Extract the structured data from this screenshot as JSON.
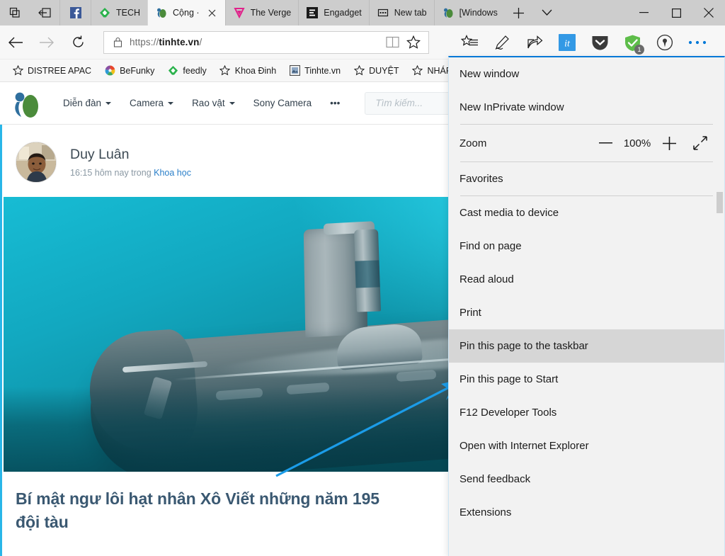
{
  "window": {
    "controls": {
      "minimize": "—",
      "maximize": "□",
      "close": "✕"
    },
    "new_tab_label": "+",
    "tab_menu_label": "⌄"
  },
  "tabstrip": {
    "sys_buttons": [
      {
        "name": "tab-preview-icon",
        "glyph": "tab-preview"
      },
      {
        "name": "set-aside-tabs-icon",
        "glyph": "set-aside"
      }
    ],
    "tabs": [
      {
        "title": "",
        "favicon": "facebook",
        "pinned": true,
        "active": false
      },
      {
        "title": "TECH",
        "favicon": "feedly",
        "pinned": false,
        "active": false
      },
      {
        "title": "Cộng ·",
        "favicon": "tinhte",
        "pinned": false,
        "active": true
      },
      {
        "title": "The Verge",
        "favicon": "theverge",
        "pinned": false,
        "active": false
      },
      {
        "title": "Engadget",
        "favicon": "engadget",
        "pinned": false,
        "active": false
      },
      {
        "title": "New tab",
        "favicon": "newtab",
        "pinned": false,
        "active": false
      },
      {
        "title": "[Windows",
        "favicon": "tinhte",
        "pinned": false,
        "active": false
      }
    ]
  },
  "toolbar": {
    "back_label": "Back",
    "forward_label": "Forward",
    "refresh_label": "Refresh",
    "url_prefix": "https://",
    "url_domain": "tinhte.vn",
    "url_suffix": "/",
    "url_full": "https://tinhte.vn/",
    "reading_view_label": "Reading view",
    "favorite_label": "Add to favorites",
    "right_icons": [
      {
        "name": "hub-favorites-icon",
        "label": "Hub"
      },
      {
        "name": "web-notes-icon",
        "label": "Make a Web Note"
      },
      {
        "name": "share-icon",
        "label": "Share"
      },
      {
        "name": "extension-tinhte-icon",
        "label": "it",
        "color": "#3399e5"
      },
      {
        "name": "pocket-extension-icon",
        "label": "Pocket",
        "color": "#3a3a3a"
      },
      {
        "name": "adblock-extension-icon",
        "label": "Adblock",
        "color": "#5ebd4a",
        "badge": "1"
      },
      {
        "name": "lastpass-extension-icon",
        "label": "LastPass",
        "color": "#3a3a3a"
      },
      {
        "name": "settings-and-more-icon",
        "label": "•••",
        "color": "#0078d7"
      }
    ]
  },
  "favorites_bar": [
    {
      "label": "DISTREE APAC",
      "icon": "star"
    },
    {
      "label": "BeFunky",
      "icon": "befunky"
    },
    {
      "label": "feedly",
      "icon": "feedly"
    },
    {
      "label": "Khoa Đinh",
      "icon": "star"
    },
    {
      "label": "Tinhte.vn",
      "icon": "tinhte-fav"
    },
    {
      "label": "DUYỆT",
      "icon": "star"
    },
    {
      "label": "NHÁP",
      "icon": "star"
    },
    {
      "label": "",
      "icon": "star"
    }
  ],
  "site": {
    "logo_name": "tinhte-logo",
    "nav": [
      {
        "label": "Diễn đàn",
        "caret": true
      },
      {
        "label": "Camera",
        "caret": true
      },
      {
        "label": "Rao vật",
        "caret": true
      },
      {
        "label": "Sony Camera",
        "caret": false
      },
      {
        "label": "•••",
        "caret": false
      }
    ],
    "search_placeholder": "Tìm kiếm..."
  },
  "post": {
    "author": "Duy Luân",
    "time_prefix": "16:15 hôm nay trong ",
    "category": "Khoa học",
    "hero_alt": "nuclear-torpedo-submarine-illustration",
    "title": "Bí mật ngư lôi hạt nhân Xô Viết những năm 195Đội tàu",
    "title_line1": "Bí mật ngư lôi hạt nhân Xô Viết những năm 195",
    "title_line2": "đội tàu"
  },
  "menu": {
    "items": [
      {
        "label": "New window",
        "type": "item",
        "highlight": false
      },
      {
        "label": "New InPrivate window",
        "type": "item",
        "highlight": false
      },
      {
        "type": "separator"
      },
      {
        "label": "Zoom",
        "type": "zoom",
        "value": "100%",
        "minus": "—",
        "plus": "+",
        "fullscreen": "fullscreen-icon"
      },
      {
        "type": "separator"
      },
      {
        "label": "Favorites",
        "type": "item",
        "highlight": false
      },
      {
        "type": "separator"
      },
      {
        "label": "Cast media to device",
        "type": "item",
        "highlight": false
      },
      {
        "label": "Find on page",
        "type": "item",
        "highlight": false
      },
      {
        "label": "Read aloud",
        "type": "item",
        "highlight": false
      },
      {
        "label": "Print",
        "type": "item",
        "highlight": false
      },
      {
        "label": "Pin this page to the taskbar",
        "type": "item",
        "highlight": true
      },
      {
        "label": "Pin this page to Start",
        "type": "item",
        "highlight": false
      },
      {
        "label": "F12 Developer Tools",
        "type": "item",
        "highlight": false
      },
      {
        "label": "Open with Internet Explorer",
        "type": "item",
        "highlight": false
      },
      {
        "label": "Send feedback",
        "type": "item",
        "highlight": false
      },
      {
        "label": "Extensions",
        "type": "item",
        "highlight": false
      }
    ],
    "zoom_label": "Zoom",
    "zoom_value": "100%"
  },
  "annotation": {
    "arrow_color": "#1b9ce8",
    "arrow_name": "pointer-arrow"
  },
  "colors": {
    "accent": "#0078d7",
    "tab_inactive": "#cdcdcd",
    "tab_active": "#f7f7f7",
    "toolbar_bg": "#f7f7f7",
    "menu_bg": "#f2f2f2",
    "menu_highlight": "#d6d6d6",
    "link": "#2a7fc9",
    "title": "#3a5871",
    "page_edge": "#29b6e8"
  }
}
